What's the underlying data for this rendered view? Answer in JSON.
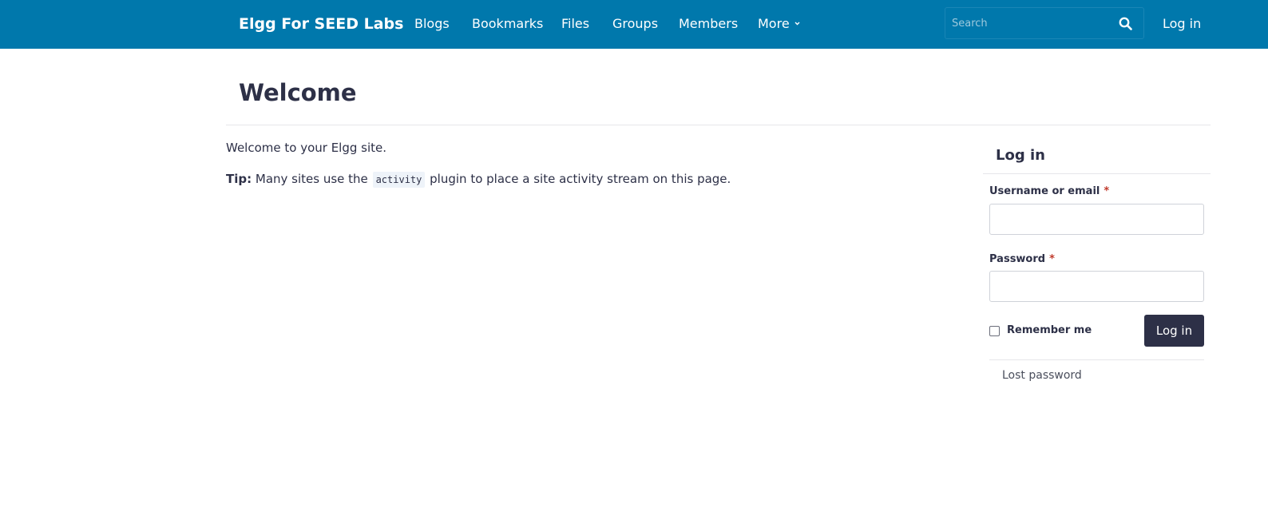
{
  "header": {
    "site_name": "Elgg For SEED Labs",
    "nav": [
      "Blogs",
      "Bookmarks",
      "Files",
      "Groups",
      "Members",
      "More"
    ],
    "search_placeholder": "Search",
    "login_link": "Log in",
    "bar_color": "#0078ac"
  },
  "main": {
    "title": "Welcome",
    "welcome": "Welcome to your Elgg site.",
    "tip_label": "Tip:",
    "tip_before": "Many sites use the",
    "tip_code": "activity",
    "tip_after": "plugin to place a site activity stream on this page."
  },
  "sidebar": {
    "title": "Log in",
    "username_label": "Username or email",
    "password_label": "Password",
    "required_mark": "*",
    "remember_label": "Remember me",
    "submit_label": "Log in",
    "lost_password": "Lost password",
    "button_color": "#2d3047"
  }
}
